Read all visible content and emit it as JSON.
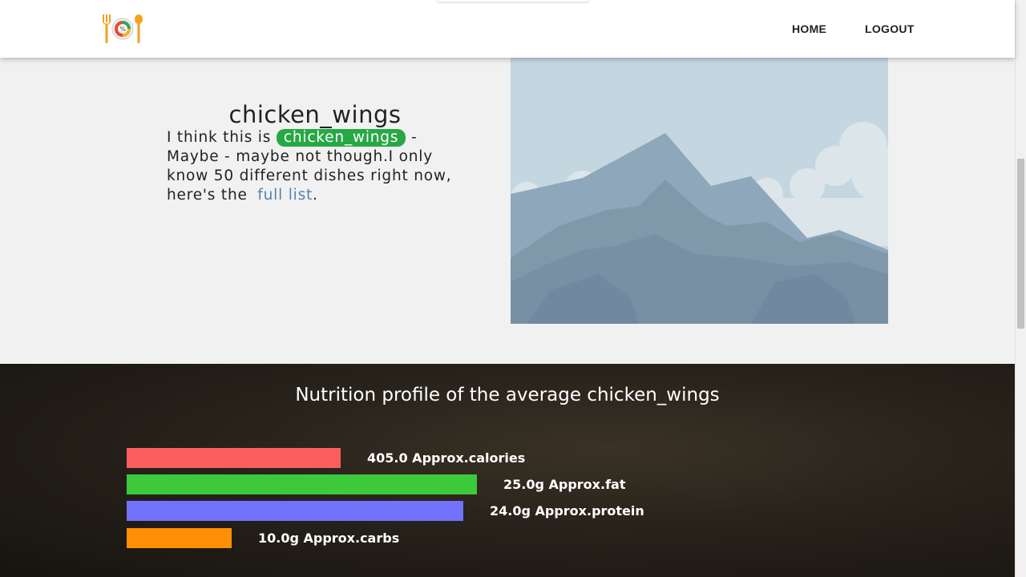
{
  "header": {
    "logo_icon": "plate-fork-spoon-logo",
    "nav": {
      "home": "HOME",
      "logout": "LOGOUT"
    }
  },
  "result": {
    "title": "chicken_wings",
    "text_prefix": "I think this is",
    "badge": "chicken_wings",
    "text_mid": "- Maybe - maybe not though.I only know 50 different dishes right now, here's the",
    "link_text": "full list",
    "text_suffix": ".",
    "badge_color": "#27a844",
    "link_color": "#5483b0"
  },
  "image": {
    "icon": "mountain-placeholder-image"
  },
  "nutrition": {
    "title": "Nutrition profile of the average chicken_wings",
    "bars": [
      {
        "label": "405.0 Approx.calories",
        "color": "#fb5e5e",
        "value": 0.61
      },
      {
        "label": "25.0g Approx.fat",
        "color": "#3cc93c",
        "value": 1.0
      },
      {
        "label": "24.0g Approx.protein",
        "color": "#7272fc",
        "value": 0.96
      },
      {
        "label": "10.0g Approx.carbs",
        "color": "#fd8f05",
        "value": 0.3
      }
    ]
  }
}
